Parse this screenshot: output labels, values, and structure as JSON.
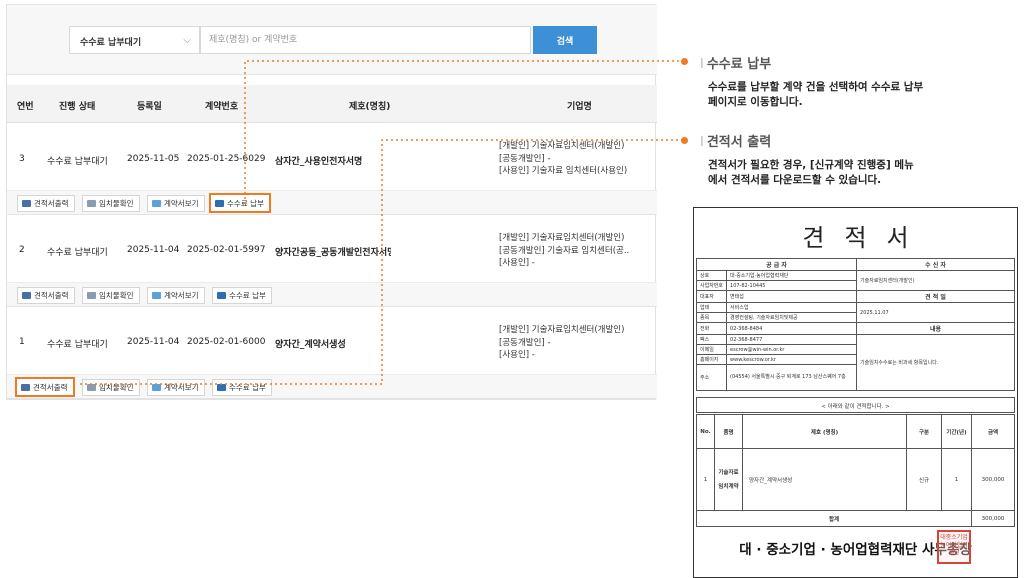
{
  "search": {
    "status_select": "수수료 납부대기",
    "keyword_placeholder": "제호(명칭) or 계약번호",
    "search_button": "검색"
  },
  "table": {
    "headers": [
      "연번",
      "진행 상태",
      "등록일",
      "계약번호",
      "제호(명칭)",
      "기업명"
    ],
    "rows": [
      {
        "no": "3",
        "status": "수수료 납부대기",
        "date": "2025-11-05",
        "contract_no": "2025-01-25-6029",
        "title": "삼자간_사용인전자서명",
        "orgs": [
          "[개발인] 기술자료임치센터(개발인)",
          "[공동개발인] -",
          "[사용인] 기술자료 임치센터(사용인)"
        ]
      },
      {
        "no": "2",
        "status": "수수료 납부대기",
        "date": "2025-11-04",
        "contract_no": "2025-02-01-5997",
        "title": "양자간공동_공동개발인전자서명",
        "orgs": [
          "[개발인] 기술자료임치센터(개발인)",
          "[공동개발인] 기술자료 임치센터(공..",
          "[사용인] -"
        ]
      },
      {
        "no": "1",
        "status": "수수료 납부대기",
        "date": "2025-11-04",
        "contract_no": "2025-02-01-6000",
        "title": "양자간_계약서생성",
        "orgs": [
          "[개발인] 기술자료임치센터(개발인)",
          "[공동개발인] -",
          "[사용인] -"
        ]
      }
    ],
    "actions": [
      "견적서출력",
      "임치물확인",
      "계약서보기",
      "수수료 납부"
    ]
  },
  "callouts": {
    "fee": {
      "title": "수수료 납부",
      "desc": [
        "수수료를 납부할 계약 건을 선택하여 수수료 납부",
        "페이지로 이동합니다."
      ]
    },
    "quote": {
      "title": "견적서 출력",
      "desc": [
        "견적서가 필요한 경우, [신규계약 진행중] 메뉴",
        "에서 견적서를 다운로드할 수 있습니다."
      ]
    }
  },
  "document": {
    "title": "견적서",
    "supplier_header": "공 급 자",
    "receiver_header": "수 신 자",
    "supplier_rows": [
      [
        "상호",
        "대·중소기업·농어업협력재단"
      ],
      [
        "사업자번호",
        "107-82-10445"
      ],
      [
        "대표자",
        "변태섭"
      ],
      [
        "업태",
        "서비스업"
      ],
      [
        "종목",
        "경영컨설팅, 기술자료임치및제공"
      ],
      [
        "전화",
        "02-368-8484"
      ],
      [
        "팩스",
        "02-368-8477"
      ],
      [
        "이메일",
        "escrow@win-win.or.kr"
      ],
      [
        "홈페이지",
        "www.kescrow.or.kr"
      ],
      [
        "주소",
        "(04554) 서울특별시 중구 퇴계로 173 남산스퀘어 7층"
      ]
    ],
    "receiver_name": "기술자료임치센터(개발인)",
    "quote_date_label": "견 적 일",
    "quote_date": "2025.11.07",
    "content_label": "내용",
    "content_text": "기술임치수수료는 비과세 항목입니다.",
    "note": "< 아래와 같이 견적합니다. >",
    "item_headers": [
      "No.",
      "품명",
      "제호 (명칭)",
      "구분",
      "기간(년)",
      "금액"
    ],
    "item": {
      "no": "1",
      "name_line1": "기술자료",
      "name_line2": "임치계약",
      "title": "양자간_계약서생성",
      "type": "신규",
      "period": "1",
      "amount": "300,000"
    },
    "total_label": "합계",
    "total_amount": "300,000",
    "signature": "대 · 중소기업 · 농어업협력재단 사무총장",
    "stamp_text": "대중소기업농어업협력재단"
  },
  "colors": {
    "accent": "#ef7a23",
    "search_button": "#3d8fd6"
  }
}
